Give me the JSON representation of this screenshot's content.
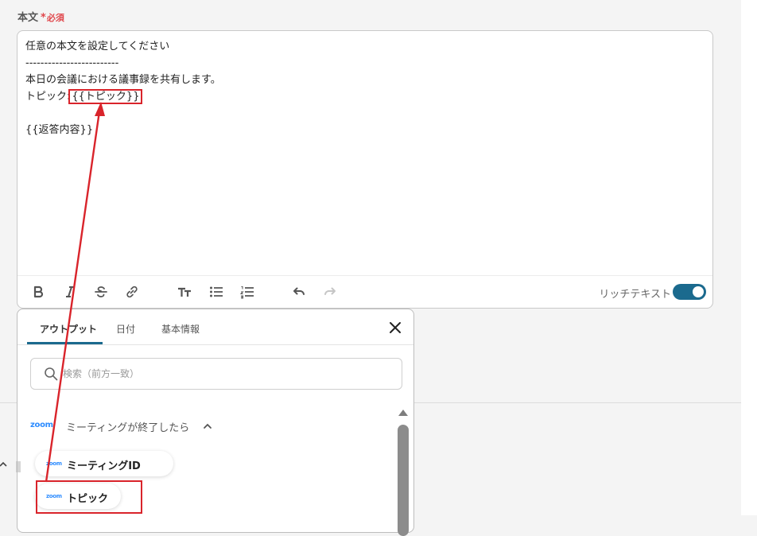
{
  "field": {
    "label": "本文",
    "required_mark": "*",
    "required_text": "必須"
  },
  "editor": {
    "lines": [
      "任意の本文を設定してください",
      "-------------------------",
      "本日の会議における議事録を共有します。",
      "",
      "",
      "{{返答内容}}"
    ],
    "topic_line_prefix": "トピック:",
    "topic_variable": "{{トピック}}",
    "rich_text_label": "リッチテキスト",
    "rich_text_enabled": true
  },
  "toolbar": {
    "icons": [
      "bold-icon",
      "italic-icon",
      "strikethrough-icon",
      "link-icon",
      "text-size-icon",
      "bullet-list-icon",
      "numbered-list-icon",
      "undo-icon",
      "redo-icon"
    ]
  },
  "panel": {
    "tabs": [
      {
        "label": "アウトプット",
        "active": true
      },
      {
        "label": "日付",
        "active": false
      },
      {
        "label": "基本情報",
        "active": false
      }
    ],
    "search_placeholder": "検索（前方一致）",
    "group": {
      "logo_text": "zoom",
      "title": "ミーティングが終了したら",
      "items": [
        {
          "label": "ミーティングID"
        },
        {
          "label": "トピック"
        }
      ]
    }
  },
  "colors": {
    "accent": "#1b6a8e",
    "required": "#e0474c",
    "highlight": "#d9242b",
    "zoom_brand": "#2d8cff"
  }
}
